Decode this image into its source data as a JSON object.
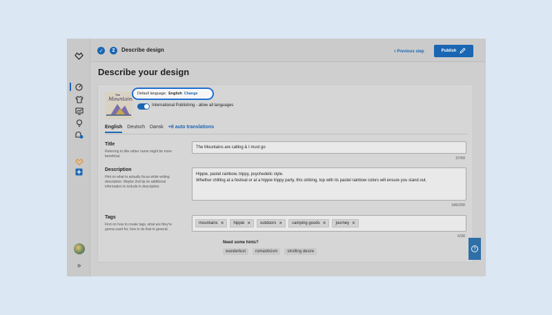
{
  "topbar": {
    "step_number": "2",
    "step_title": "Describe design",
    "previous_label": "Previous step",
    "publish_label": "Publish"
  },
  "page": {
    "title": "Describe your design"
  },
  "language": {
    "default_label": "Default language:",
    "default_value": "English",
    "change_label": "Change",
    "international_label": "International Publishing - allow all languages",
    "international_on": true
  },
  "thumbnail": {
    "line1": "The",
    "line2": "Mountains"
  },
  "tabs": [
    {
      "label": "English",
      "active": true
    },
    {
      "label": "Deutsch"
    },
    {
      "label": "Dansk"
    },
    {
      "label": "+8 auto translations"
    }
  ],
  "title_field": {
    "label": "Title",
    "hint": "Referring to title rather name might be more beneficial.",
    "value": "The Mountains are calling & I must go",
    "count": "37/50"
  },
  "description_field": {
    "label": "Description",
    "hint": "Hint on what to actually focus while writing description. Maybe 2nd tip on additional information to include in description.",
    "line1": "Hippie, pastel rainbow, trippy, psychedelic style.",
    "line2": "Whether chilling at a festival or at a hippie trippy party, this striking, top with its pastel rainbow colors will ensure you stand out.",
    "count": "186/200"
  },
  "tags_field": {
    "label": "Tags",
    "hint": "First on how to create tags, what are they're gonna used for, how to do that in general.",
    "tags": [
      "mountains",
      "hippie",
      "outdoors",
      "camping goods",
      "journey"
    ],
    "count": "5/30"
  },
  "hints": {
    "title": "Need some hints?",
    "items": [
      "wanderlust",
      "romanticism",
      "strolling desire"
    ]
  },
  "colors": {
    "accent": "#1a66b3",
    "highlight": "#1d6bd0"
  }
}
